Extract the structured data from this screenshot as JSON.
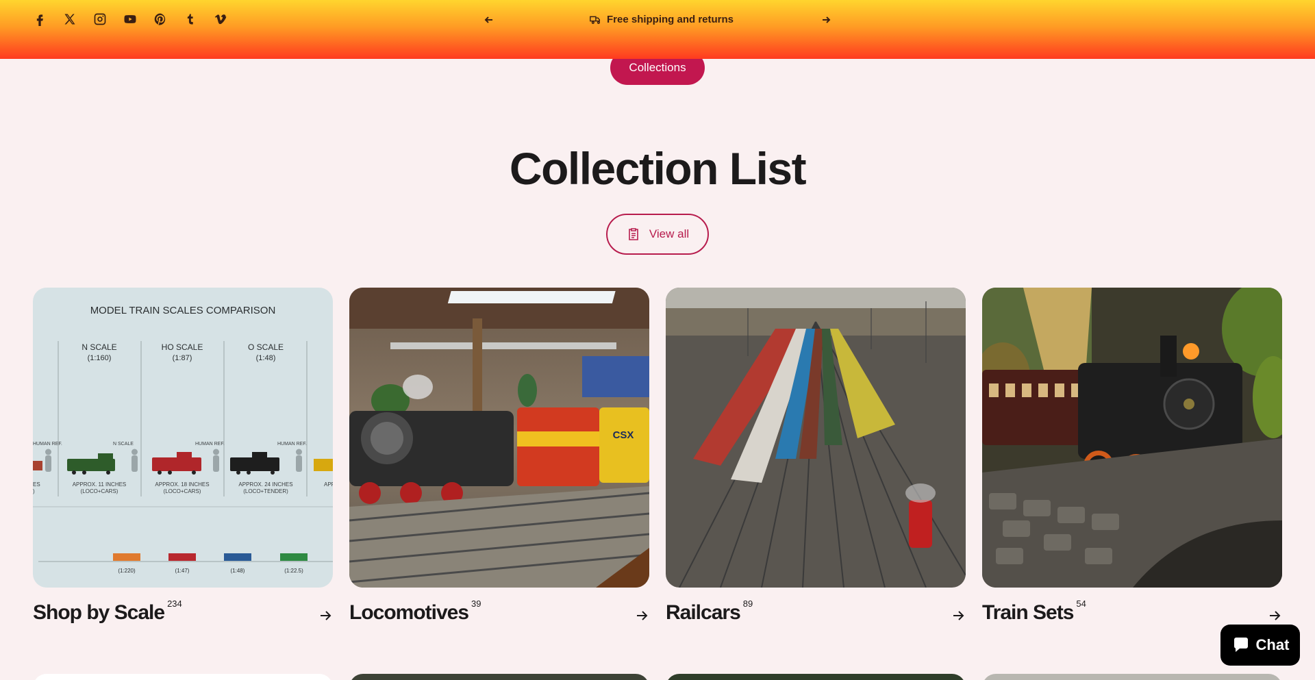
{
  "announcement": {
    "text": "Free shipping and returns",
    "prev_label": "Previous announcement",
    "next_label": "Next announcement"
  },
  "social": [
    {
      "name": "facebook"
    },
    {
      "name": "x-twitter"
    },
    {
      "name": "instagram"
    },
    {
      "name": "youtube"
    },
    {
      "name": "pinterest"
    },
    {
      "name": "tumblr"
    },
    {
      "name": "vimeo"
    }
  ],
  "breadcrumb_pill": "Collections",
  "heading": "Collection List",
  "view_all": "View all",
  "collections": [
    {
      "title": "Shop by Scale",
      "count": "234"
    },
    {
      "title": "Locomotives",
      "count": "39"
    },
    {
      "title": "Railcars",
      "count": "89"
    },
    {
      "title": "Train Sets",
      "count": "54"
    }
  ],
  "scale_chart": {
    "title": "MODEL TRAIN SCALES COMPARISON",
    "scales": [
      {
        "name": "N SCALE",
        "ratio": "(1:160)",
        "desc1": "APPROX. 11 INCHES",
        "desc2": "(LOCO+CARS)",
        "ref": "N SCALE"
      },
      {
        "name": "HO SCALE",
        "ratio": "(1:87)",
        "desc1": "APPROX. 18 INCHES",
        "desc2": "(LOCO+CARS)",
        "ref": "HUMAN REF."
      },
      {
        "name": "O SCALE",
        "ratio": "(1:48)",
        "desc1": "APPROX. 24 INCHES",
        "desc2": "(LOCO+TENDER)",
        "ref": "HUMAN REF."
      }
    ],
    "left_ref": "HUMAN REF.",
    "left_frag1": "ES",
    "left_frag2": ")",
    "right_frag": "APF",
    "bottom_ratios": [
      "(1:220)",
      "(1:47)",
      "(1:48)",
      "(1:22.5)"
    ]
  },
  "loco_badge": "CSX",
  "chat": "Chat",
  "colors": {
    "accent": "#c2174f",
    "background": "#faf0f1",
    "topbar_top": "#ffd52e",
    "topbar_bottom": "#ff3a1f"
  }
}
